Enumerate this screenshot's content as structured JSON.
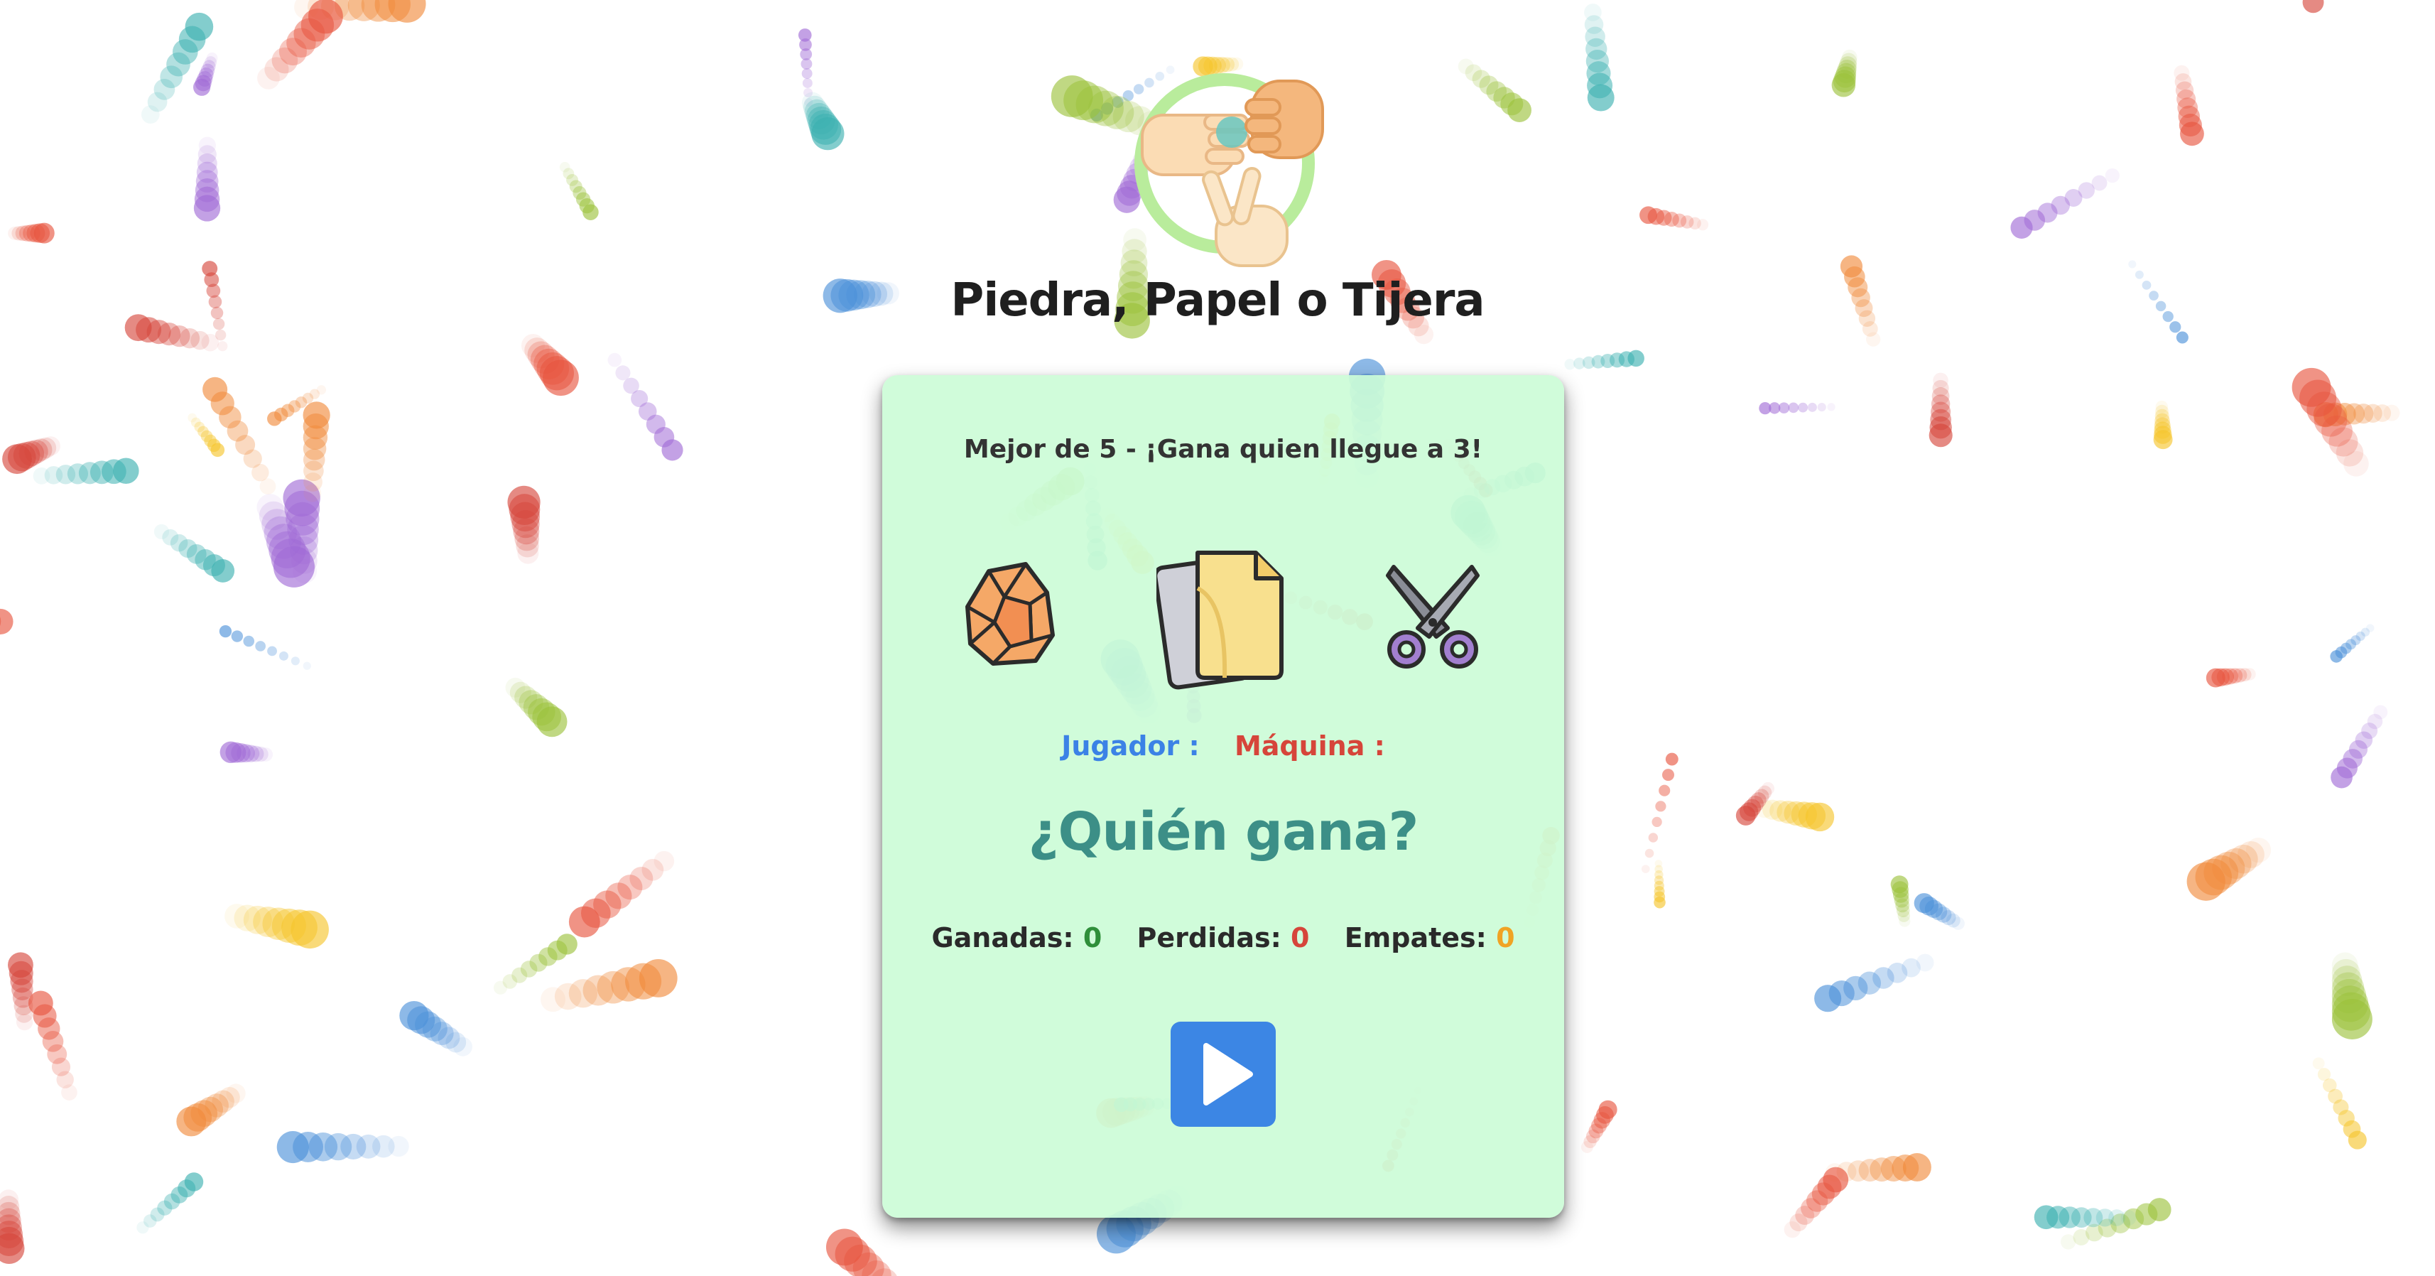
{
  "header": {
    "title": "Piedra, Papel o Tijera",
    "logo_icon": "rock-paper-scissors-hands-logo-icon"
  },
  "card": {
    "subtitle": "Mejor de 5 - ¡Gana quien llegue a 3!",
    "choices": [
      {
        "name": "rock",
        "icon": "rock-icon"
      },
      {
        "name": "paper",
        "icon": "paper-icon"
      },
      {
        "name": "scissors",
        "icon": "scissors-icon"
      }
    ],
    "player_label": "Jugador :",
    "machine_label": "Máquina :",
    "result_text": "¿Quién gana?",
    "score": {
      "won_label": "Ganadas:",
      "won_value": "0",
      "lost_label": "Perdidas:",
      "lost_value": "0",
      "tie_label": "Empates:",
      "tie_value": "0"
    },
    "play_icon": "play-icon"
  },
  "colors": {
    "card_background": "#ccfcd7",
    "player": "#3b82e6",
    "machine": "#d6453a",
    "result": "#3c8f87",
    "won": "#2f8f3a",
    "lost": "#d6453a",
    "tie": "#f0a324",
    "play_button": "#3c86e4",
    "confetti": [
      "#e8543e",
      "#3bb0b0",
      "#f5c52a",
      "#9bc23a",
      "#a06ad6",
      "#4a90d9",
      "#f08a3a",
      "#d6453a"
    ]
  }
}
